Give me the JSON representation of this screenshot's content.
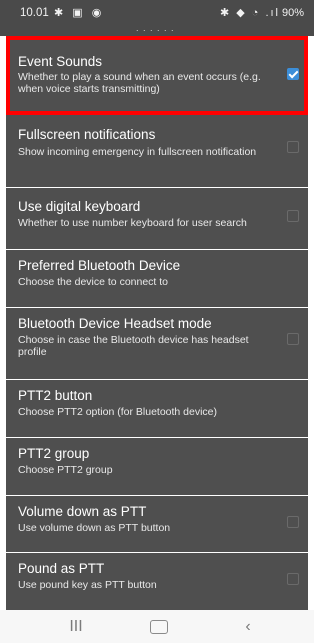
{
  "status_bar": {
    "time": "10.01",
    "left_icons": "✱ ▣ ◉",
    "right_icons": "✱ ◆ ◔ .ıl",
    "battery": "90%"
  },
  "preferences": [
    {
      "title": "Event Sounds",
      "summary": "Whether to play a sound when an event occurs (e.g. when voice starts transmitting)",
      "checkbox": true,
      "checked": true
    },
    {
      "title": "Fullscreen notifications",
      "summary": "Show incoming emergency in fullscreen notification",
      "checkbox": true,
      "checked": false
    },
    {
      "title": "Use digital keyboard",
      "summary": "Whether to use number keyboard for user search",
      "checkbox": true,
      "checked": false
    },
    {
      "title": "Preferred Bluetooth Device",
      "summary": "Choose the device to connect to",
      "checkbox": false,
      "checked": false
    },
    {
      "title": "Bluetooth Device Headset mode",
      "summary": "Choose in case the Bluetooth device has headset profile",
      "checkbox": true,
      "checked": false
    },
    {
      "title": "PTT2 button",
      "summary": "Choose PTT2 option (for Bluetooth device)",
      "checkbox": false,
      "checked": false
    },
    {
      "title": "PTT2 group",
      "summary": "Choose PTT2 group",
      "checkbox": false,
      "checked": false
    },
    {
      "title": "Volume down as PTT",
      "summary": "Use volume down as PTT button",
      "checkbox": true,
      "checked": false
    },
    {
      "title": "Pound as PTT",
      "summary": "Use pound key as PTT button",
      "checkbox": true,
      "checked": false
    }
  ],
  "nav": {
    "recents_icon": "recents-icon",
    "home_icon": "home-icon",
    "back_icon": "back-icon",
    "recents_glyph": "III",
    "back_glyph": "‹"
  },
  "colors": {
    "row_bg": "#4f4f4f",
    "highlight": "#ff0000",
    "checked_accent": "#3c8ed8"
  }
}
